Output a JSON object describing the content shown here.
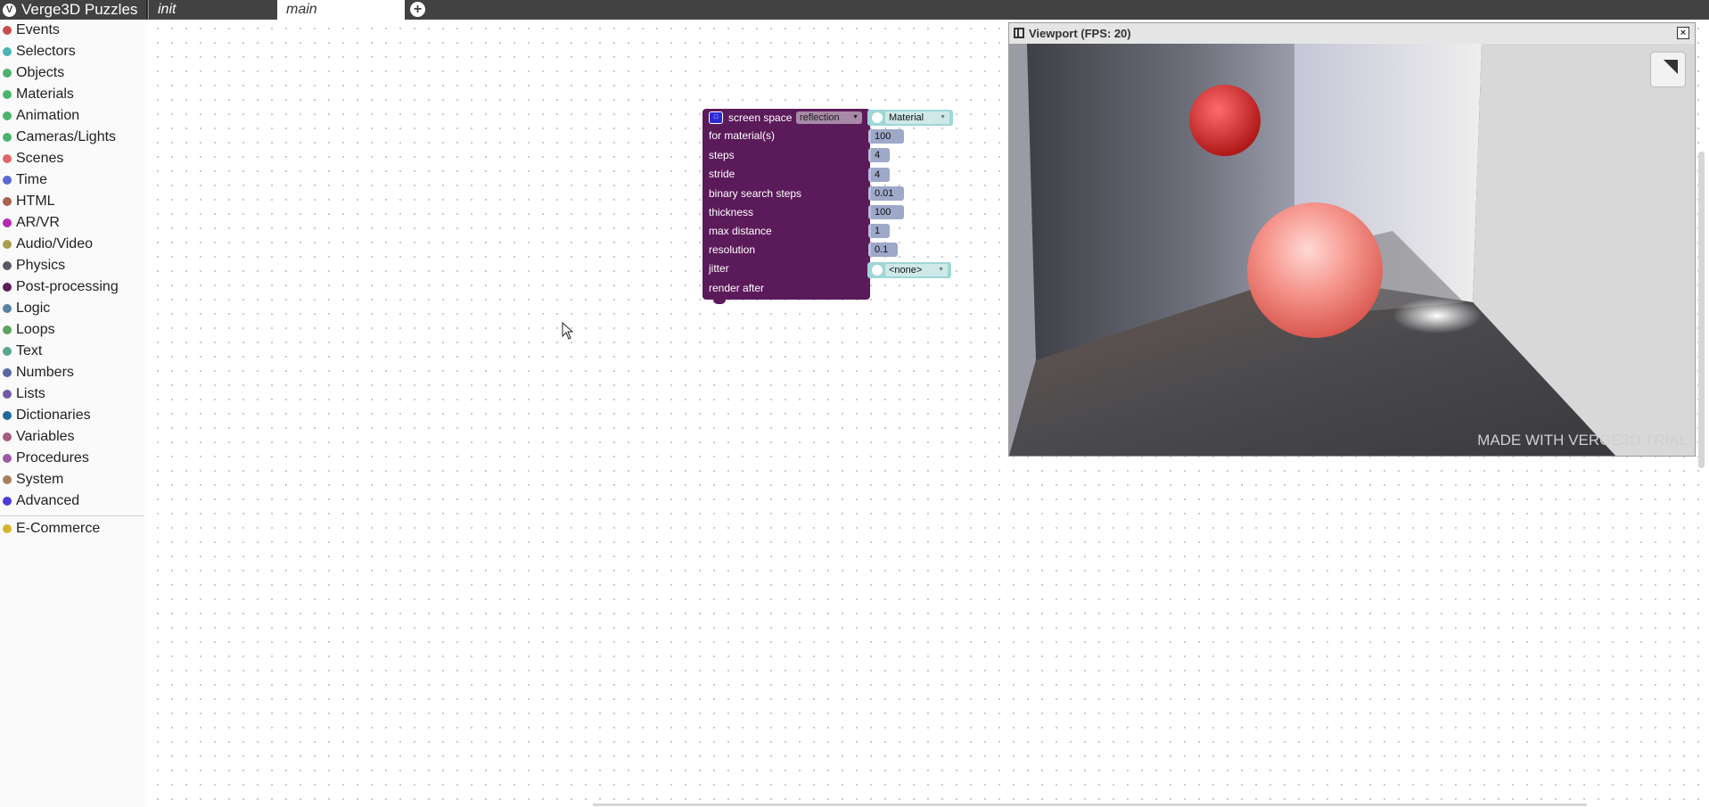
{
  "app": {
    "title": "Verge3D Puzzles",
    "logo": "verge3d-logo-icon"
  },
  "tabs": [
    {
      "label": "init",
      "active": false
    },
    {
      "label": "main",
      "active": true
    }
  ],
  "add_tab_icon": "plus-circle-icon",
  "sidebar": {
    "categories": [
      {
        "label": "Events",
        "color": "#c94b4b"
      },
      {
        "label": "Selectors",
        "color": "#4bb3b3"
      },
      {
        "label": "Objects",
        "color": "#4bb36b"
      },
      {
        "label": "Materials",
        "color": "#4bb36b"
      },
      {
        "label": "Animation",
        "color": "#4bb36b"
      },
      {
        "label": "Cameras/Lights",
        "color": "#4bb36b"
      },
      {
        "label": "Scenes",
        "color": "#e06666"
      },
      {
        "label": "Time",
        "color": "#5b67d6"
      },
      {
        "label": "HTML",
        "color": "#a8624b"
      },
      {
        "label": "AR/VR",
        "color": "#b32bb3"
      },
      {
        "label": "Audio/Video",
        "color": "#a8a04b"
      },
      {
        "label": "Physics",
        "color": "#5b5b66"
      },
      {
        "label": "Post-processing",
        "color": "#5b1a5a"
      },
      {
        "label": "Logic",
        "color": "#5b80a5"
      },
      {
        "label": "Loops",
        "color": "#5ba55b"
      },
      {
        "label": "Text",
        "color": "#5ba58c"
      },
      {
        "label": "Numbers",
        "color": "#5b67a5"
      },
      {
        "label": "Lists",
        "color": "#745ba5"
      },
      {
        "label": "Dictionaries",
        "color": "#1f6a9a"
      },
      {
        "label": "Variables",
        "color": "#a55b80"
      },
      {
        "label": "Procedures",
        "color": "#995ba5"
      },
      {
        "label": "System",
        "color": "#a5805b"
      },
      {
        "label": "Advanced",
        "color": "#4b3bd6"
      }
    ],
    "extra": [
      {
        "label": "E-Commerce",
        "color": "#d6b32b"
      }
    ]
  },
  "block": {
    "title": "screen space",
    "mode": "reflection",
    "icon": "camera-block-icon",
    "rows": [
      {
        "label": "for material(s)",
        "value": "Material",
        "kind": "material"
      },
      {
        "label": "steps",
        "value": "100",
        "kind": "number"
      },
      {
        "label": "stride",
        "value": "4",
        "kind": "number"
      },
      {
        "label": "binary search steps",
        "value": "4",
        "kind": "number"
      },
      {
        "label": "thickness",
        "value": "0.01",
        "kind": "number"
      },
      {
        "label": "max distance",
        "value": "100",
        "kind": "number"
      },
      {
        "label": "resolution",
        "value": "1",
        "kind": "number"
      },
      {
        "label": "jitter",
        "value": "0.1",
        "kind": "number"
      },
      {
        "label": "render after",
        "value": "<none>",
        "kind": "object"
      }
    ]
  },
  "viewport": {
    "title": "Viewport (FPS: 20)",
    "watermark": "MADE WITH VERGE3D TRIAL",
    "pause_icon": "pause-icon",
    "close_icon": "close-icon",
    "fullscreen_icon": "fullscreen-icon"
  }
}
